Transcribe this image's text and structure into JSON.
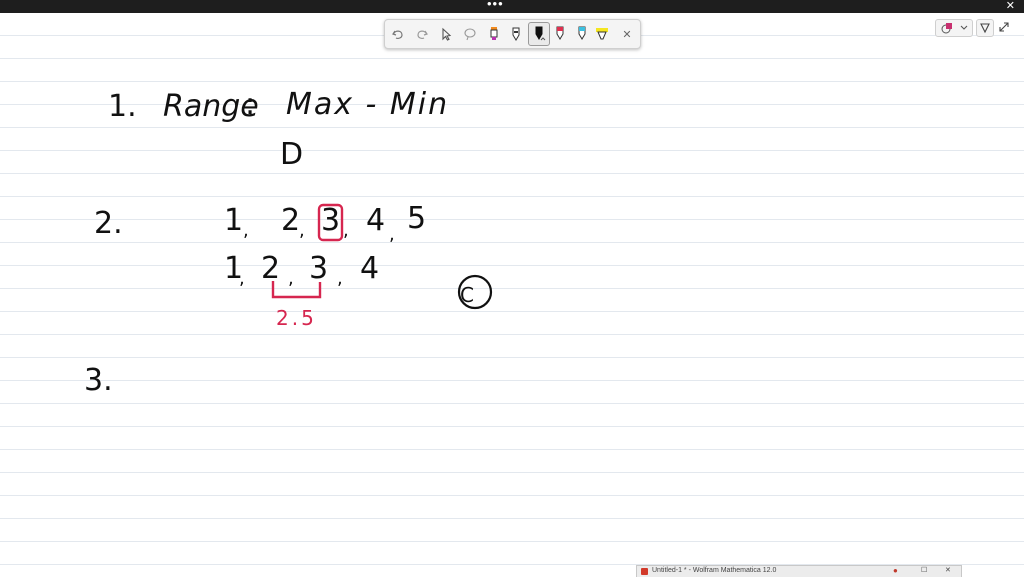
{
  "window": {
    "menu_dots": "•••",
    "close_glyph": "✕"
  },
  "toolbar": {
    "tools": [
      "undo-icon",
      "redo-icon",
      "select-icon",
      "lasso-icon",
      "pen-orange-icon",
      "pen-outline-icon",
      "pen-black-icon",
      "pen-red-icon",
      "pen-cyan-icon",
      "highlighter-yellow-icon",
      "close-icon"
    ],
    "close_glyph": "✕"
  },
  "notes": {
    "item1_number": "1.",
    "item1_label": "Range",
    "item1_colon": ":",
    "item1_formula": "Max - Min",
    "item1_answer": "D",
    "item2_number": "2.",
    "item2_row1": [
      "1",
      "2",
      "3",
      "4",
      "5"
    ],
    "item2_row2": [
      "1",
      "2",
      "3",
      "4"
    ],
    "item2_median": "2.5",
    "item2_answer": "C",
    "item3_number": "3."
  },
  "colors": {
    "ink_black": "#111111",
    "ink_red": "#d6264f",
    "ruled_line": "#e3e8ee"
  },
  "taskbar": {
    "window_title": "Untitled-1 * - Wolfram Mathematica 12.0",
    "pin_glyph": "●",
    "maximize_glyph": "☐",
    "close_glyph": "✕"
  }
}
